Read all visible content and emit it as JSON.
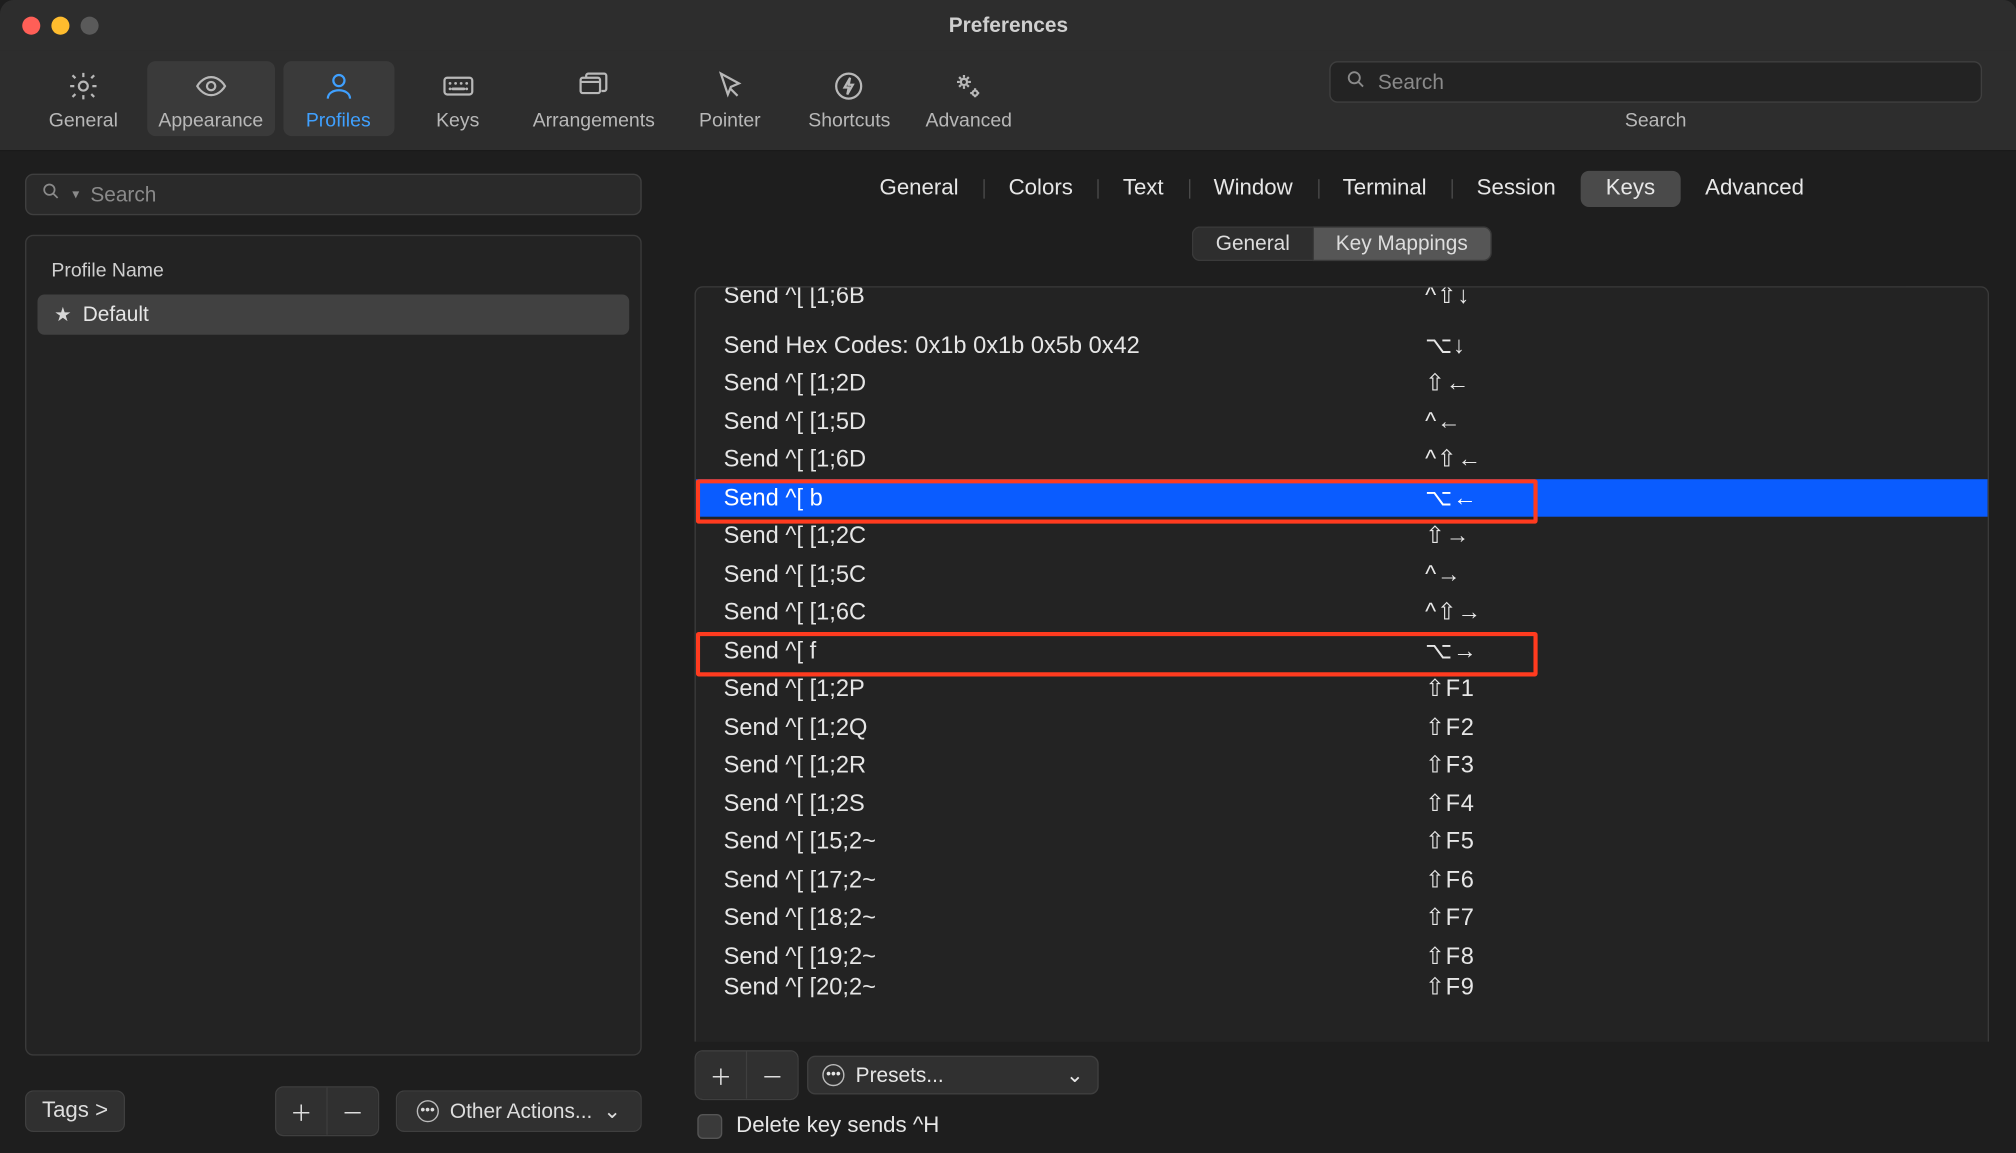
{
  "window": {
    "title": "Preferences"
  },
  "toolbar": {
    "items": [
      {
        "label": "General"
      },
      {
        "label": "Appearance"
      },
      {
        "label": "Profiles"
      },
      {
        "label": "Keys"
      },
      {
        "label": "Arrangements"
      },
      {
        "label": "Pointer"
      },
      {
        "label": "Shortcuts"
      },
      {
        "label": "Advanced"
      }
    ],
    "search_placeholder": "Search",
    "search_label": "Search"
  },
  "sidebar": {
    "search_placeholder": "Search",
    "header": "Profile Name",
    "profiles": [
      {
        "name": "Default",
        "starred": true,
        "selected": true
      }
    ],
    "tags_label": "Tags >",
    "other_actions_label": "Other Actions..."
  },
  "panel": {
    "tabs": [
      "General",
      "Colors",
      "Text",
      "Window",
      "Terminal",
      "Session",
      "Keys",
      "Advanced"
    ],
    "active_tab": "Keys",
    "subtabs": [
      "General",
      "Key Mappings"
    ],
    "active_subtab": "Key Mappings",
    "mappings": [
      {
        "action": "Send ^[ [1;6B",
        "shortcut": "^⇧↓",
        "cutoff_top": true
      },
      {
        "action": "Send Hex Codes: 0x1b 0x1b 0x5b 0x42",
        "shortcut": "⌥↓"
      },
      {
        "action": "Send ^[ [1;2D",
        "shortcut": "⇧←"
      },
      {
        "action": "Send ^[ [1;5D",
        "shortcut": "^←"
      },
      {
        "action": "Send ^[ [1;6D",
        "shortcut": "^⇧←"
      },
      {
        "action": "Send ^[ b",
        "shortcut": "⌥←",
        "selected": true,
        "boxed": true
      },
      {
        "action": "Send ^[ [1;2C",
        "shortcut": "⇧→"
      },
      {
        "action": "Send ^[ [1;5C",
        "shortcut": "^→"
      },
      {
        "action": "Send ^[ [1;6C",
        "shortcut": "^⇧→"
      },
      {
        "action": "Send ^[ f",
        "shortcut": "⌥→",
        "boxed": true
      },
      {
        "action": "Send ^[ [1;2P",
        "shortcut": "⇧F1"
      },
      {
        "action": "Send ^[ [1;2Q",
        "shortcut": "⇧F2"
      },
      {
        "action": "Send ^[ [1;2R",
        "shortcut": "⇧F3"
      },
      {
        "action": "Send ^[ [1;2S",
        "shortcut": "⇧F4"
      },
      {
        "action": "Send ^[ [15;2~",
        "shortcut": "⇧F5"
      },
      {
        "action": "Send ^[ [17;2~",
        "shortcut": "⇧F6"
      },
      {
        "action": "Send ^[ [18;2~",
        "shortcut": "⇧F7"
      },
      {
        "action": "Send ^[ [19;2~",
        "shortcut": "⇧F8"
      },
      {
        "action": "Send ^[ [20;2~",
        "shortcut": "⇧F9",
        "cutoff_bot": true
      }
    ],
    "presets_label": "Presets...",
    "delete_key_label": "Delete key sends ^H",
    "delete_key_checked": false
  }
}
